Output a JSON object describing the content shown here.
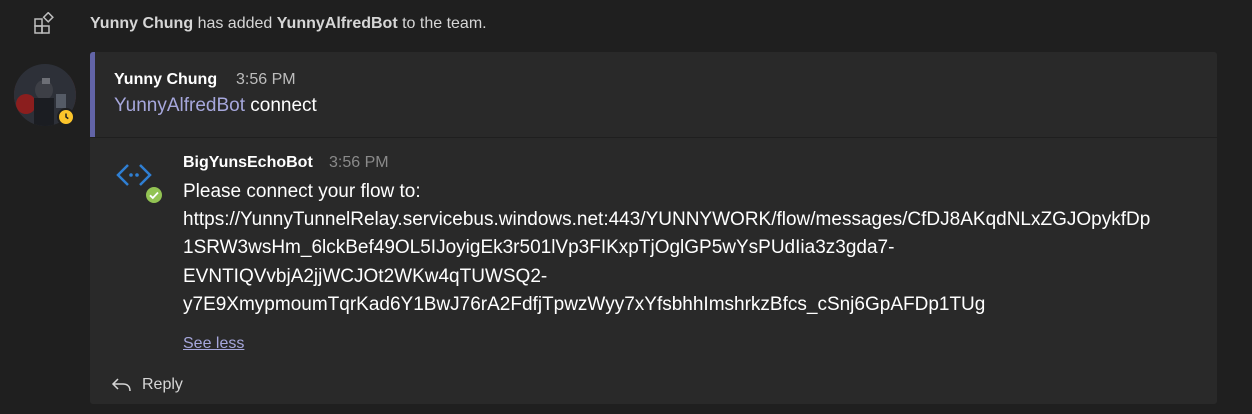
{
  "system_message": {
    "actor": "Yunny Chung",
    "action": "has added",
    "target": "YunnyAlfredBot",
    "suffix": "to the team.",
    "icon": "apps-grid-icon"
  },
  "message": {
    "author": "Yunny Chung",
    "time": "3:56 PM",
    "mention": "YunnyAlfredBot",
    "text": "connect",
    "avatar_status": "away",
    "accent_color": "#6264a7"
  },
  "reply": {
    "author": "BigYunsEchoBot",
    "time": "3:56 PM",
    "lines": [
      "Please connect your flow to:",
      "https://YunnyTunnelRelay.servicebus.windows.net:443/YUNNYWORK/flow/messages/CfDJ8AKqdNLxZGJOpykfDp",
      "1SRW3wsHm_6lckBef49OL5IJoyigEk3r501lVp3FIKxpTjOglGP5wYsPUdIia3z3gda7-",
      "EVNTIQVvbjA2jjWCJOt2WKw4qTUWSQ2-",
      "y7E9XmypmoumTqrKad6Y1BwJ76rA2FdfjTpwzWyy7xYfsbhhImshrkzBfcs_cSnj6GpAFDp1TUg"
    ],
    "status_color": "#92c353",
    "icon": "bot-code-icon"
  },
  "see_less_label": "See less",
  "reply_button_label": "Reply"
}
